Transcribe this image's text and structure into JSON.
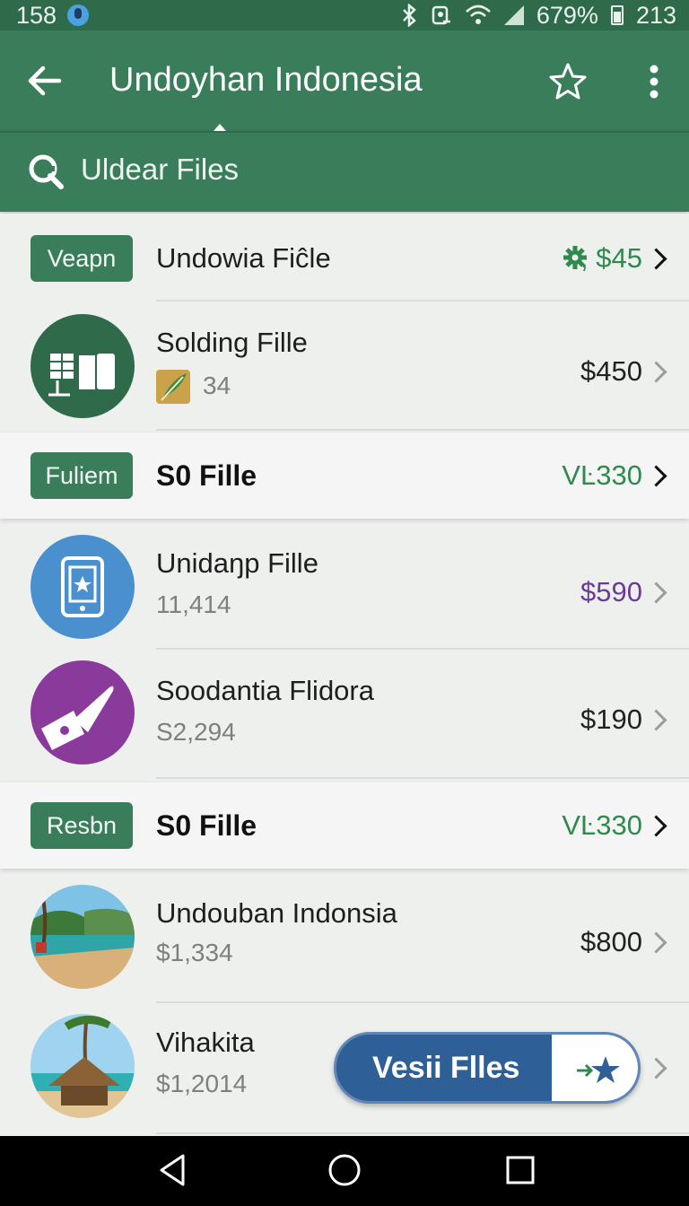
{
  "status_bar": {
    "time_left": "158",
    "battery_percent": "679%",
    "time_right": "213",
    "icons": [
      "app-notification-icon",
      "bluetooth-icon",
      "alarm-icon",
      "wifi-icon",
      "signal-icon",
      "battery-icon"
    ]
  },
  "app_bar": {
    "title": "Undoyhan Indonesia",
    "icons": [
      "back-arrow-icon",
      "star-icon",
      "more-vert-icon"
    ]
  },
  "search": {
    "label": "Uldear Files",
    "icon": "search-icon"
  },
  "list": [
    {
      "type": "header",
      "badge": "Veapn",
      "title": "Undowia Fiĉle",
      "price": "$45",
      "price_icon": "gear-icon",
      "price_color": "#2f8a4e"
    },
    {
      "type": "item",
      "title": "Solding Fille",
      "sub": "34",
      "sub_icon": "feather-app-icon",
      "price": "$450",
      "icon": "solar-panel-icon",
      "price_color": "#222222"
    },
    {
      "type": "header",
      "badge": "Fuliem",
      "title": "S0 Fille",
      "price": "VĿ330",
      "price_color": "#2f8a4e"
    },
    {
      "type": "item",
      "title": "Unidaŋp Fille",
      "sub": "11,414",
      "price": "$590",
      "icon": "mobile-star-icon",
      "price_color": "#6a3c9a"
    },
    {
      "type": "item",
      "title": "Soodantia Flidora",
      "sub": "S2,294",
      "price": "$190",
      "icon": "ticket-slash-icon",
      "price_color": "#222222"
    },
    {
      "type": "header",
      "badge": "Resbn",
      "title": "S0 Fille",
      "price": "VĿ330",
      "price_color": "#2f8a4e"
    },
    {
      "type": "item",
      "title": "Undouban Indonsia",
      "sub": "$1,334",
      "price": "$800",
      "icon": "beach-photo",
      "price_color": "#222222"
    },
    {
      "type": "item",
      "title": "Vihakita",
      "sub": "$1,2014",
      "icon": "hut-photo"
    }
  ],
  "fab": {
    "label": "Vesii Flles",
    "icon": "star-arrow-icon"
  },
  "nav_bar": {
    "icons": [
      "back-triangle-icon",
      "home-circle-icon",
      "recents-square-icon"
    ]
  },
  "colors": {
    "primary": "#3a7d5a",
    "status": "#2f6b4b",
    "accent_green": "#2f8a4e",
    "accent_purple": "#6a3c9a",
    "fab_blue": "#2f5f97"
  }
}
